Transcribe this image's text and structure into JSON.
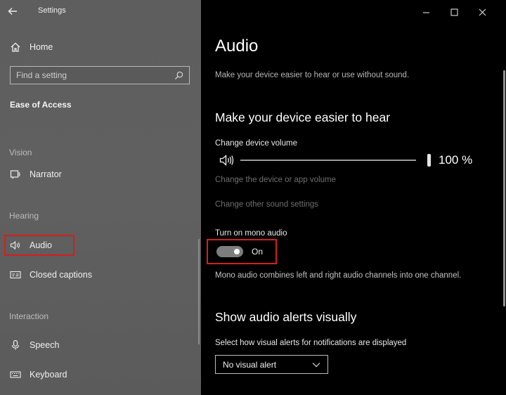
{
  "window": {
    "title": "Settings"
  },
  "sidebar": {
    "home_label": "Home",
    "search_placeholder": "Find a setting",
    "section_title": "Ease of Access",
    "groups": {
      "vision": "Vision",
      "hearing": "Hearing",
      "interaction": "Interaction"
    },
    "items": {
      "narrator": "Narrator",
      "audio": "Audio",
      "closed_captions": "Closed captions",
      "speech": "Speech",
      "keyboard": "Keyboard"
    },
    "selected": "Audio"
  },
  "main": {
    "title": "Audio",
    "subtitle": "Make your device easier to hear or use without sound.",
    "hear_section": {
      "title": "Make your device easier to hear",
      "volume_label": "Change device volume",
      "volume_value": "100 %",
      "volume_level_percent": 100,
      "app_volume_link": "Change the device or app volume",
      "sound_settings_link": "Change other sound settings",
      "mono_label": "Turn on mono audio",
      "mono_state": "On",
      "mono_desc": "Mono audio combines left and right audio channels into one channel."
    },
    "alerts_section": {
      "title": "Show audio alerts visually",
      "select_label": "Select how visual alerts for notifications are displayed",
      "select_value": "No visual alert"
    }
  },
  "colors": {
    "sidebar_bg": "#5e5e5e",
    "main_bg": "#000000",
    "highlight": "#d2201d",
    "toggle_track": "#7d7d7d"
  },
  "icons": {
    "back": "back-arrow-icon",
    "home": "home-icon",
    "search": "search-icon",
    "narrator": "narrator-icon",
    "audio": "speaker-icon",
    "closed_captions": "cc-icon",
    "speech": "microphone-icon",
    "keyboard": "keyboard-icon",
    "minimize": "minimize-icon",
    "maximize": "maximize-icon",
    "close": "close-icon",
    "dropdown": "chevron-down-icon"
  }
}
